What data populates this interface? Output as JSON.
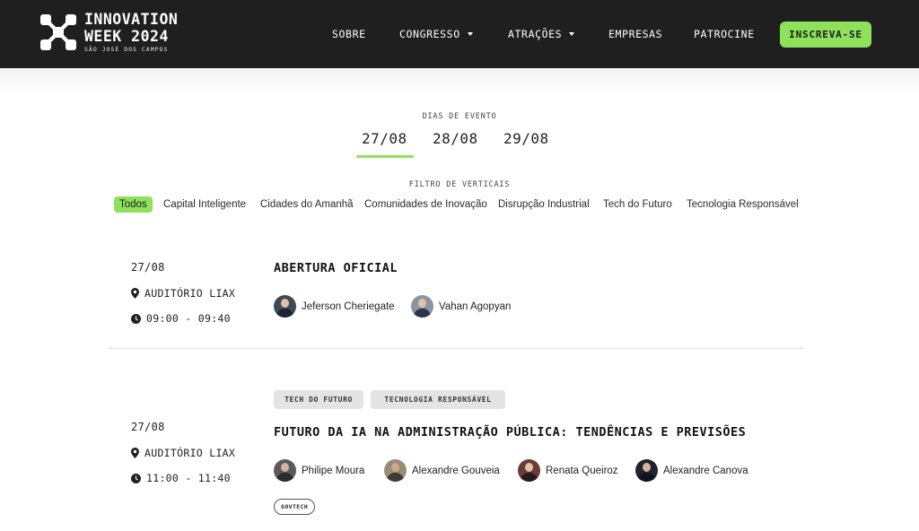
{
  "brand": {
    "line1": "INNOVATION",
    "line2": "WEEK 2024",
    "sub": "SÃO JOSÉ DOS CAMPOS",
    "accent": "#8ee25b",
    "header_bg": "#1f1f1f"
  },
  "nav": {
    "items": [
      {
        "label": "SOBRE",
        "dropdown": false
      },
      {
        "label": "CONGRESSO",
        "dropdown": true
      },
      {
        "label": "ATRAÇÕES",
        "dropdown": true
      },
      {
        "label": "EMPRESAS",
        "dropdown": false
      },
      {
        "label": "PATROCINE",
        "dropdown": false
      }
    ],
    "cta": "INSCREVA-SE"
  },
  "days": {
    "label": "DIAS DE EVENTO",
    "tabs": [
      "27/08",
      "28/08",
      "29/08"
    ],
    "active": "27/08"
  },
  "filters": {
    "label": "FILTRO DE VERTICAIS",
    "items": [
      "Todos",
      "Capital Inteligente",
      "Cidades do Amanhã",
      "Comunidades de Inovação",
      "Disrupção Industrial",
      "Tech do Futuro",
      "Tecnologia Responsável"
    ],
    "active": "Todos"
  },
  "sessions": [
    {
      "date": "27/08",
      "location": "AUDITÓRIO LIAX",
      "time": "09:00 - 09:40",
      "title": "ABERTURA OFICIAL",
      "speakers": [
        "Jeferson Cheriegate",
        "Vahan Agopyan"
      ]
    },
    {
      "tags": [
        "TECH DO FUTURO",
        "TECNOLOGIA RESPONSÁVEL"
      ],
      "date": "27/08",
      "location": "AUDITÓRIO LIAX",
      "time": "11:00 - 11:40",
      "title": "FUTURO DA IA NA ADMINISTRAÇÃO PÚBLICA: TENDÊNCIAS E PREVISÕES",
      "speakers": [
        "Philipe Moura",
        "Alexandre Gouveia",
        "Renata Queiroz",
        "Alexandre Canova"
      ],
      "category": "GOVTECH"
    }
  ]
}
